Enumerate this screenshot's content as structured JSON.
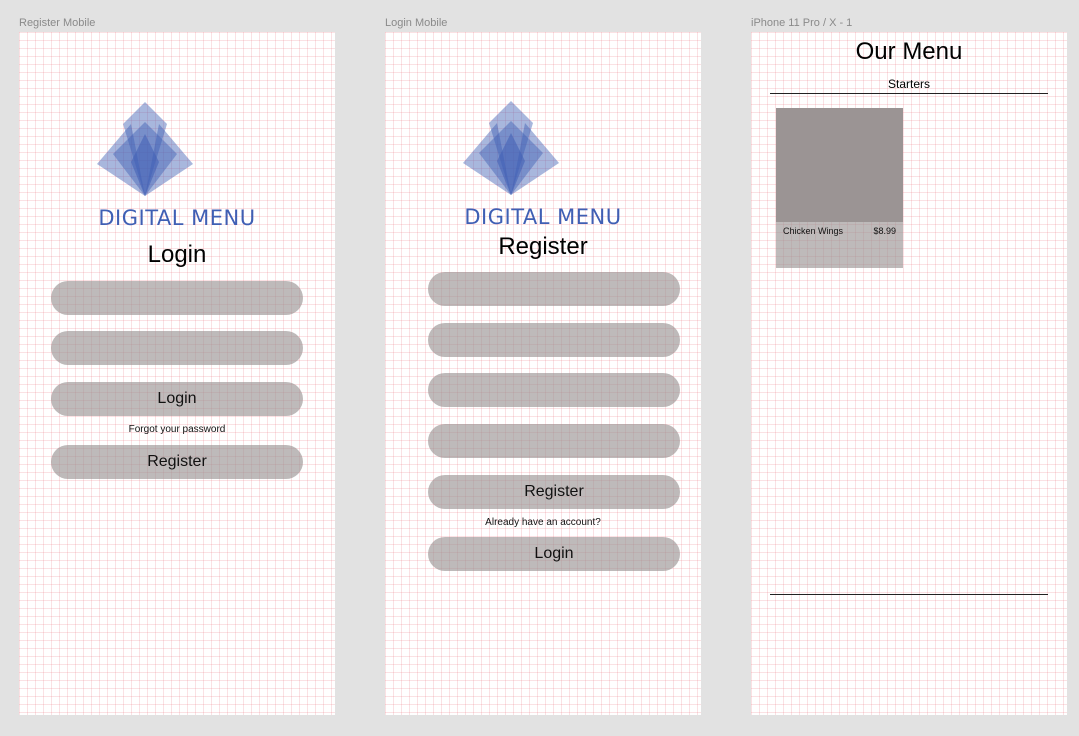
{
  "canvas_labels": {
    "register_mobile": "Register Mobile",
    "login_mobile": "Login Mobile",
    "iphone": "iPhone 11 Pro / X - 1"
  },
  "brand": {
    "name": "DIGITAL MENU",
    "logo_icon": "lotus-logo-icon",
    "brand_color": "#3f5fb4"
  },
  "login_screen": {
    "heading": "Login",
    "username_value": "",
    "password_value": "",
    "login_button": "Login",
    "forgot_password": "Forgot your password",
    "register_button": "Register"
  },
  "register_screen": {
    "heading": "Register",
    "field_values": [
      "",
      "",
      "",
      ""
    ],
    "register_button": "Register",
    "already_account": "Already have an account?",
    "login_button": "Login"
  },
  "menu_screen": {
    "title": "Our Menu",
    "category": "Starters",
    "items": [
      {
        "name": "Chicken Wings",
        "price": "$8.99"
      }
    ]
  },
  "colors": {
    "canvas_bg": "#e2e2e2",
    "pill_fill": "#b9b3b3",
    "grid_line": "#f1b8bd"
  }
}
